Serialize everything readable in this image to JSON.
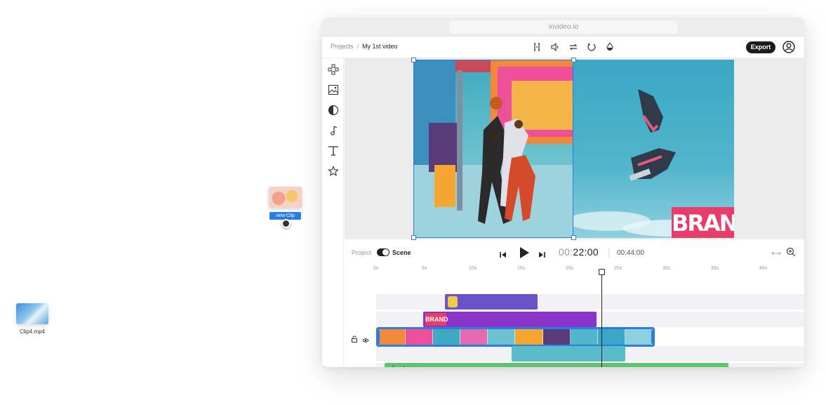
{
  "browser": {
    "url": "invideo.io"
  },
  "breadcrumb": {
    "root": "Projects",
    "separator": "/",
    "current": "My 1st video"
  },
  "toolbar": {
    "icons": [
      "split-icon",
      "volume-icon",
      "swap-icon",
      "rotate-icon",
      "color-drop-icon"
    ],
    "export_label": "Export"
  },
  "sidebar": {
    "icons": [
      "layout-icon",
      "media-icon",
      "sticker-icon",
      "music-icon",
      "text-icon",
      "star-icon"
    ]
  },
  "canvas": {
    "brand_text": "BRAND"
  },
  "timeline": {
    "mode_label_project": "Project",
    "mode_label_scene": "Scene",
    "current_time_prefix": "00:",
    "current_time_main": "22:00",
    "total_time": "00:44:00",
    "ruler_ticks": [
      "0s",
      "5s",
      "10s",
      "15s",
      "20s",
      "25s",
      "30s",
      "35s",
      "40s"
    ],
    "brand_clip_label": "BRAND",
    "playhead_seconds": 22
  },
  "drag_item": {
    "label": "new Clip"
  },
  "desktop_file": {
    "name": "Clip4.mp4"
  },
  "colors": {
    "accent": "#2a7de1",
    "emoji_clip": "#6a52c8",
    "brand_clip": "#8a34c9",
    "audio_clip": "#5cc56e",
    "shoes_clip": "#59bccb"
  }
}
